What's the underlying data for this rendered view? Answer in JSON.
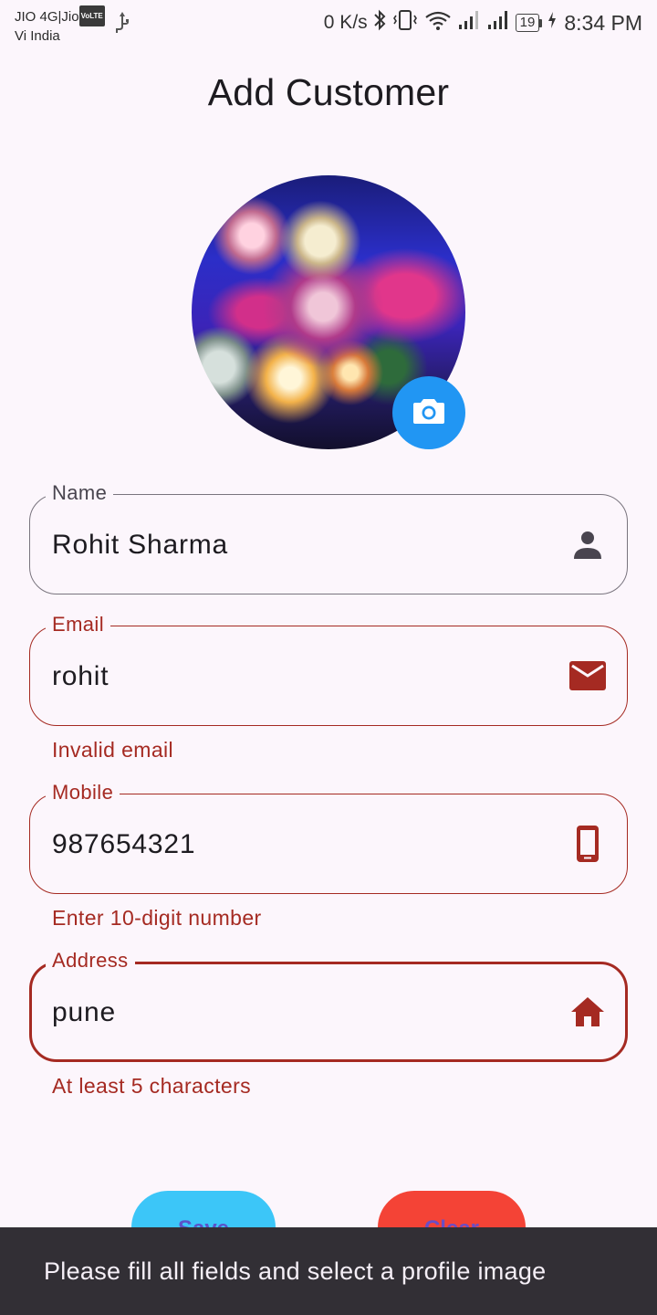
{
  "status_bar": {
    "carrier_line1": "JIO 4G|Jio",
    "volte_badge": "VoLTE",
    "carrier_line2": "Vi India",
    "net_speed": "0 K/s",
    "battery_level": "19",
    "time": "8:34 PM"
  },
  "page": {
    "title": "Add Customer"
  },
  "avatar": {
    "icon": "camera-icon",
    "fab_color": "#2196f3"
  },
  "form": {
    "name": {
      "label": "Name",
      "value": "Rohit Sharma",
      "icon": "person-icon"
    },
    "email": {
      "label": "Email",
      "value": "rohit",
      "icon": "mail-icon",
      "error": "Invalid email"
    },
    "mobile": {
      "label": "Mobile",
      "value": "987654321",
      "icon": "phone-icon",
      "error": "Enter 10-digit number"
    },
    "address": {
      "label": "Address",
      "value": "pune",
      "icon": "home-icon",
      "error": "At least 5 characters"
    }
  },
  "buttons": {
    "save_label": "Save",
    "clear_label": "Clear"
  },
  "snackbar": {
    "message": "Please fill all fields and select a profile image"
  },
  "colors": {
    "background": "#fcf6fc",
    "error": "#a52a22",
    "save_button": "#3cc6f8",
    "clear_button": "#f44336",
    "snackbar": "#322f35"
  }
}
